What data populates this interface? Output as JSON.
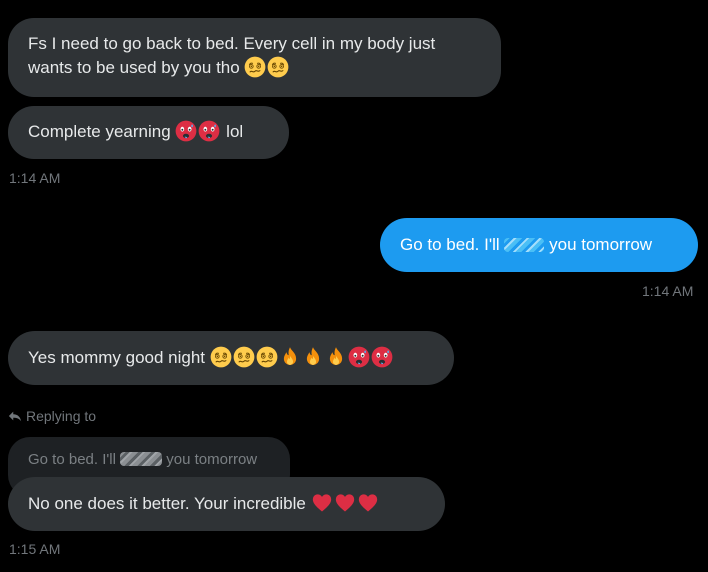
{
  "colors": {
    "background": "#000000",
    "received_bubble": "#2f3336",
    "sent_bubble": "#1d9bf0",
    "timestamp": "#71767b",
    "text": "#e7e9ea"
  },
  "messages": {
    "m1": {
      "line1": "Fs I need to go back to bed. Every cell in my body just",
      "line2": "wants to be used by you tho",
      "emojis": [
        "woozy-face-icon",
        "woozy-face-icon"
      ]
    },
    "m2": {
      "text_before": "Complete yearning",
      "emojis": [
        "hot-face-icon",
        "hot-face-icon"
      ],
      "text_after": "lol"
    },
    "ts1": "1:14 AM",
    "m3": {
      "text_before": "Go to bed. I'll",
      "text_after": "you tomorrow"
    },
    "ts2": "1:14 AM",
    "m4": {
      "text": "Yes mommy good night",
      "emojis": [
        "woozy-face-icon",
        "woozy-face-icon",
        "woozy-face-icon",
        "fire-icon",
        "fire-icon",
        "fire-icon",
        "hot-face-icon",
        "hot-face-icon"
      ]
    },
    "reply": {
      "label": "Replying to",
      "quoted_before": "Go to bed. I'll",
      "quoted_after": "you tomorrow"
    },
    "m5": {
      "text": "No one does it better. Your incredible",
      "emojis": [
        "red-heart-icon",
        "red-heart-icon",
        "red-heart-icon"
      ]
    },
    "ts3": "1:15 AM"
  }
}
